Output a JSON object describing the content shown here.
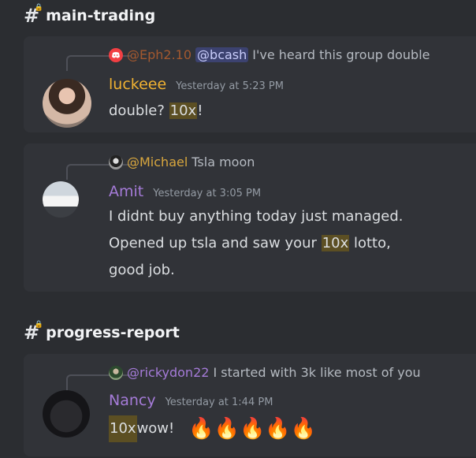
{
  "channels": [
    {
      "name": "main-trading"
    },
    {
      "name": "progress-report"
    }
  ],
  "messages": [
    {
      "reply_author": "@Eph2.10",
      "reply_mention": "@bcash",
      "reply_text": "I've heard this group double",
      "author": "luckeee",
      "timestamp": "Yesterday at 5:23 PM",
      "text_before": "double? ",
      "highlight": "10x",
      "text_after": "!"
    },
    {
      "reply_author": "@Michael",
      "reply_text": "Tsla moon",
      "author": "Amit",
      "timestamp": "Yesterday at 3:05 PM",
      "line1": "I didnt buy anything today just managed.",
      "line2_before": "Opened up tsla and saw your ",
      "highlight": "10x",
      "line2_after": " lotto,",
      "line3": "good job."
    },
    {
      "reply_author": "@rickydon22",
      "reply_text": "I started with 3k like most of you",
      "author": "Nancy",
      "timestamp": "Yesterday at 1:44 PM",
      "highlight": "10x",
      "text_after": " wow!",
      "emoji": [
        "🔥",
        "🔥",
        "🔥",
        "🔥",
        "🔥"
      ]
    }
  ],
  "colors": {
    "luckeee": "#f0b232",
    "amit": "#a57bd8",
    "nancy": "#a57bd8",
    "eph": "#c0622d",
    "michael": "#d9a73e",
    "rickydon": "#a57bd8",
    "highlight_bg": "#5c4f23"
  },
  "icons": [
    "hash-lock-icon",
    "discord-icon"
  ]
}
